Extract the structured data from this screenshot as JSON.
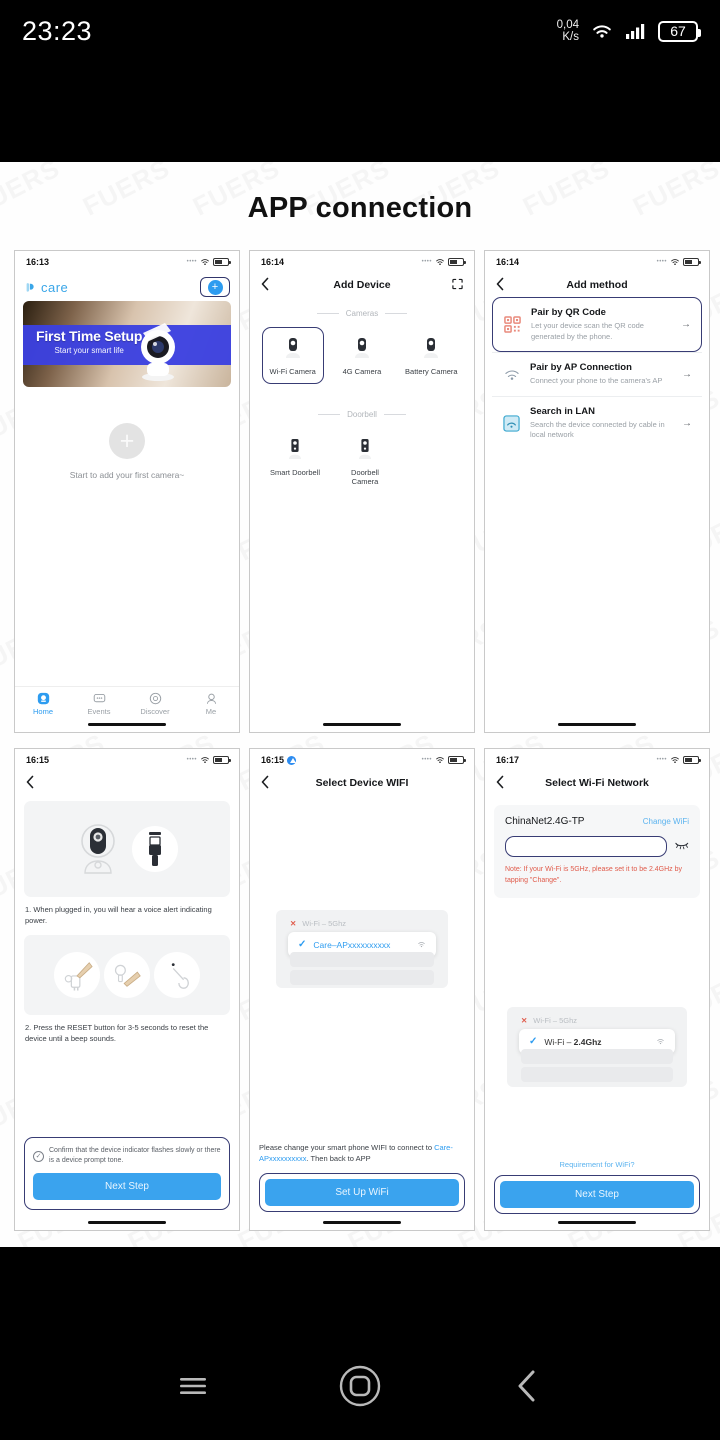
{
  "statusbar": {
    "clock": "23:23",
    "net_speed_value": "0,04",
    "net_speed_unit": "K/s",
    "battery_percent": "67",
    "wifi_icon": "wifi-icon",
    "signal_icon": "cellular-signal-icon"
  },
  "page": {
    "title": "APP connection",
    "watermark": "FUERS"
  },
  "shots": [
    {
      "id": "home-screen",
      "status_time": "16:13",
      "logo_text": "care",
      "add_button_label": "+",
      "banner": {
        "title": "First Time Setup",
        "subtitle": "Start your smart life"
      },
      "empty_text": "Start to add your first camera~",
      "empty_plus": "+",
      "tabs": [
        {
          "label": "Home",
          "icon": "home-icon",
          "active": true
        },
        {
          "label": "Events",
          "icon": "events-icon",
          "active": false
        },
        {
          "label": "Discover",
          "icon": "discover-icon",
          "active": false
        },
        {
          "label": "Me",
          "icon": "me-icon",
          "active": false
        }
      ]
    },
    {
      "id": "add-device",
      "status_time": "16:14",
      "nav_title": "Add Device",
      "back_icon": "chevron-left-icon",
      "scan_icon": "scan-frame-icon",
      "section_cameras": "Cameras",
      "section_doorbell": "Doorbell",
      "cameras": [
        {
          "label": "Wi-Fi Camera",
          "selected": true
        },
        {
          "label": "4G Camera",
          "selected": false
        },
        {
          "label": "Battery Camera",
          "selected": false
        }
      ],
      "doorbells": [
        {
          "label": "Smart Doorbell",
          "selected": false
        },
        {
          "label": "Doorbell Camera",
          "selected": false
        }
      ]
    },
    {
      "id": "add-method",
      "status_time": "16:14",
      "nav_title": "Add method",
      "methods": [
        {
          "title": "Pair by QR Code",
          "subtitle": "Let your device scan the QR code generated by the phone.",
          "icon": "qr-code-icon",
          "selected": true,
          "arrow": "→"
        },
        {
          "title": "Pair by AP Connection",
          "subtitle": "Connect your phone to the camera's AP",
          "icon": "wifi-ap-icon",
          "selected": false,
          "arrow": "→"
        },
        {
          "title": "Search in LAN",
          "subtitle": "Search the device connected by cable in local network",
          "icon": "lan-icon",
          "selected": false,
          "arrow": "→"
        }
      ]
    },
    {
      "id": "reset-device",
      "status_time": "16:15",
      "step1": "1. When plugged in, you will hear a voice alert indicating power.",
      "step2": "2. Press the RESET button for 3-5 seconds to reset the device until a beep sounds.",
      "confirm_text": "Confirm that the device indicator flashes slowly or there is a device prompt tone.",
      "confirm_icon": "check-circle-icon",
      "next_button": "Next Step"
    },
    {
      "id": "select-device-wifi",
      "status_time": "16:15",
      "nav_title": "Select Device WIFI",
      "ghost_wifi": "Wi-Fi – 5Ghz",
      "ghost_mark": "✕",
      "selected_wifi": "Care–APxxxxxxxxxx",
      "selected_mark": "✓",
      "hint_prefix": "Please change your smart phone WIFI to connect to ",
      "hint_ap": "Care-APxxxxxxxxxx",
      "hint_suffix": ". Then back to APP",
      "setup_button": "Set Up WiFi"
    },
    {
      "id": "select-wifi-network",
      "status_time": "16:17",
      "nav_title": "Select Wi-Fi Network",
      "ssid": "ChinaNet2.4G-TP",
      "change_link": "Change WiFi",
      "password_value": "",
      "password_placeholder": "",
      "eye_icon": "eye-off-icon",
      "warn_text": "Note: If your Wi-Fi is 5GHz, please set it to be 2.4GHz by tapping \"Change\".",
      "ghost_wifi": "Wi-Fi – 5Ghz",
      "ghost_mark": "✕",
      "selected_wifi_prefix": "Wi-Fi – ",
      "selected_wifi_band": "2.4Ghz",
      "selected_mark": "✓",
      "requirement_link": "Requirement for WiFi?",
      "next_button": "Next Step"
    }
  ],
  "android_nav": {
    "recents": "recents-icon",
    "home": "home-circle-icon",
    "back": "back-chevron-icon"
  },
  "colors": {
    "accent_blue": "#3aa3ee",
    "brand_blue": "#2d9cf0",
    "outline_navy": "#383c74",
    "warn_red": "#e05b4b"
  }
}
